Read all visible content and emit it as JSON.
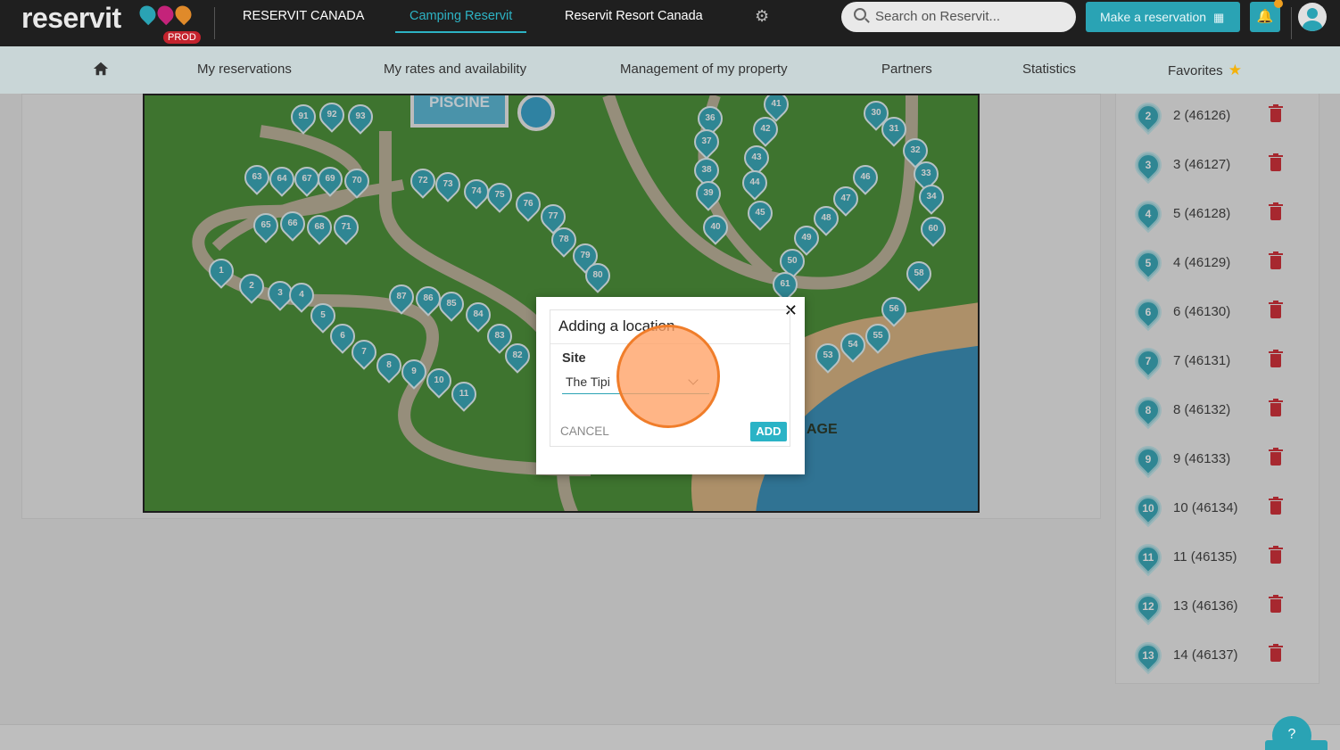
{
  "brand": {
    "logo_text": "reservit",
    "env_badge": "PROD"
  },
  "top_nav": {
    "items": [
      "RESERVIT CANADA",
      "Camping Reservit",
      "Reservit Resort Canada"
    ],
    "active": "Camping Reservit"
  },
  "search": {
    "placeholder": "Search on Reservit..."
  },
  "make_reservation": {
    "label": "Make a reservation"
  },
  "sub_nav": {
    "items": [
      "My reservations",
      "My rates and availability",
      "Management of my property",
      "Partners",
      "Statistics",
      "Favorites"
    ]
  },
  "map": {
    "pool_label": "PISCINE",
    "beach_label": "AGE",
    "pins": [
      "1",
      "2",
      "3",
      "4",
      "5",
      "6",
      "7",
      "8",
      "9",
      "10",
      "11",
      "30",
      "31",
      "32",
      "33",
      "34",
      "36",
      "37",
      "38",
      "39",
      "40",
      "41",
      "42",
      "43",
      "44",
      "45",
      "46",
      "47",
      "48",
      "49",
      "50",
      "53",
      "54",
      "55",
      "56",
      "58",
      "60",
      "61",
      "63",
      "64",
      "65",
      "66",
      "67",
      "68",
      "69",
      "70",
      "71",
      "72",
      "73",
      "74",
      "75",
      "76",
      "77",
      "78",
      "79",
      "80",
      "82",
      "83",
      "84",
      "85",
      "86",
      "87",
      "91",
      "92",
      "93"
    ]
  },
  "modal": {
    "title": "Adding a location",
    "site_label": "Site",
    "site_value": "The Tipi",
    "cancel_label": "CANCEL",
    "add_label": "ADD"
  },
  "site_list": [
    {
      "badge": "2",
      "label": "2 (46126)"
    },
    {
      "badge": "3",
      "label": "3 (46127)"
    },
    {
      "badge": "4",
      "label": "5 (46128)"
    },
    {
      "badge": "5",
      "label": "4 (46129)"
    },
    {
      "badge": "6",
      "label": "6 (46130)"
    },
    {
      "badge": "7",
      "label": "7 (46131)"
    },
    {
      "badge": "8",
      "label": "8 (46132)"
    },
    {
      "badge": "9",
      "label": "9 (46133)"
    },
    {
      "badge": "10",
      "label": "10 (46134)"
    },
    {
      "badge": "11",
      "label": "11 (46135)"
    },
    {
      "badge": "12",
      "label": "13 (46136)"
    },
    {
      "badge": "13",
      "label": "14 (46137)"
    }
  ],
  "help": {
    "label": "?"
  },
  "colors": {
    "accent": "#2aa3b4",
    "topbar": "#1f1f1f",
    "subnav": "#c9d6d7",
    "delete": "#d0202a",
    "favorite_star": "#f3b10a",
    "click_indicator": "#f07d2a"
  }
}
